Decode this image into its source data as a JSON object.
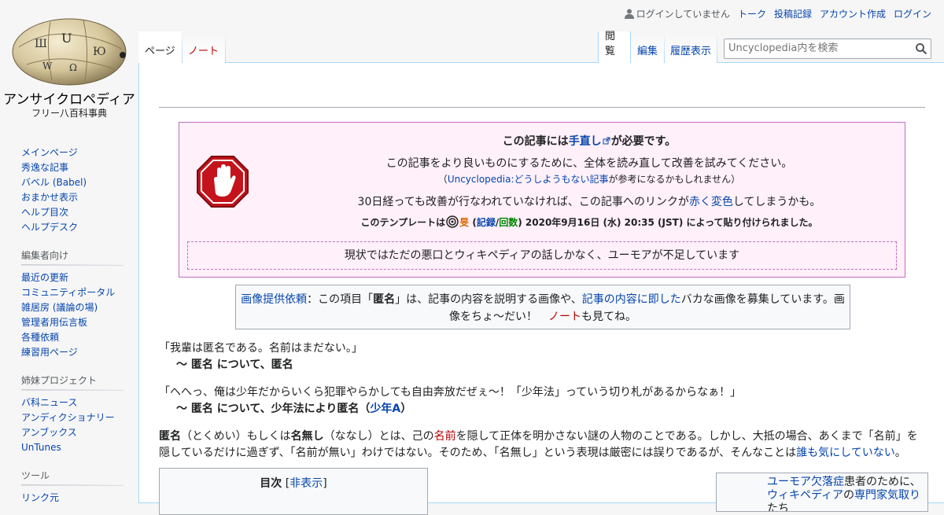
{
  "logo": {
    "site_name": "アンサイクロペディア",
    "tagline": "フリー八百科事典"
  },
  "sidebar": {
    "main_links": [
      "メインページ",
      "秀逸な記事",
      "バベル (Babel)",
      "おまかせ表示",
      "ヘルプ目次",
      "ヘルプデスク"
    ],
    "editors": {
      "heading": "編集者向け",
      "links": [
        "最近の更新",
        "コミュニティポータル",
        "雑居房 (議論の場)",
        "管理者用伝言板",
        "各種依頼",
        "練習用ページ"
      ]
    },
    "sister": {
      "heading": "姉妹プロジェクト",
      "links": [
        "バ科ニュース",
        "アンディクショナリー",
        "アンブックス",
        "UnTunes"
      ]
    },
    "tools": {
      "heading": "ツール",
      "links": [
        "リンク元"
      ]
    }
  },
  "personal": {
    "anon": "ログインしていません",
    "links": [
      "トーク",
      "投稿記録",
      "アカウント作成",
      "ログイン"
    ]
  },
  "tabs": {
    "page": "ページ",
    "note": "ノート",
    "read": "閲覧",
    "edit": "編集",
    "history": "履歴表示"
  },
  "search": {
    "placeholder": "Uncyclopedia内を検索"
  },
  "cleanup": {
    "title_pre": "この記事には",
    "title_link": "手直し",
    "title_post": "が必要です。",
    "line2": "この記事をより良いものにするために、全体を読み直して改善を試みてください。",
    "line3_open": "（",
    "line3_link": "Uncyclopedia:どうしようもない記事",
    "line3_post": "が参考になるかもしれません）",
    "line4_pre": "30日経っても改善が行なわれていなければ、この記事へのリンクが",
    "line4_link": "赤く変色",
    "line4_post": "してしまうかも。",
    "line5_pre": "このテンプレートは",
    "line5_user": "旻",
    "line5_paren_open": " (",
    "line5_log": "記録",
    "line5_slash": "/",
    "line5_count": "回数",
    "line5_post": ") 2020年9月16日 (水) 20:35 (JST) によって貼り付けられました。",
    "reason": "現状ではただの悪口とウィキペディアの話しかなく、ユーモアが不足しています"
  },
  "imgreq": {
    "link1": "画像提供依頼",
    "text1": "：この項目「",
    "bold": "匿名",
    "text2": "」は、記事の内容を説明する画像や、",
    "link2": "記事の内容に即した",
    "text3": "バカな画像を募集しています。画像をちょ～だい！　",
    "link3": "ノート",
    "text4": "も見てね。"
  },
  "quote1": {
    "text": "「我輩は匿名である。名前はまだない。」",
    "by": "〜 匿名 について、匿名"
  },
  "quote2": {
    "text": "「へへっ、俺は少年だからいくら犯罪やらかしても自由奔放だぜぇ〜！「少年法」っていう切り札があるからなぁ！」",
    "by_pre": "〜 匿名 について、少年法により匿名（",
    "by_link": "少年A",
    "by_post": "）"
  },
  "intro": {
    "b1": "匿名",
    "t1": "（とくめい）もしくは",
    "b2": "名無し",
    "t2": "（ななし）とは、己の",
    "link_red": "名前",
    "t3": "を隠して正体を明かさない謎の人物のことである。しかし、大抵の場合、あくまで「名前」を隠しているだけに過ぎず、「名前が無い」わけではない。そのため、「名無し」という表現は厳密には誤りであるが、そんなことは",
    "link": "誰も気にしていない",
    "t4": "。"
  },
  "toc": {
    "title": "目次",
    "bracket_open": " [",
    "toggle": "非表示",
    "bracket_close": "]"
  },
  "sidebox": {
    "link1": "ユーモア欠落症",
    "text1": "患者のために、",
    "link2": "ウィキペディア",
    "text2": "の",
    "link3": "専門家気取り",
    "text3": "たち"
  }
}
